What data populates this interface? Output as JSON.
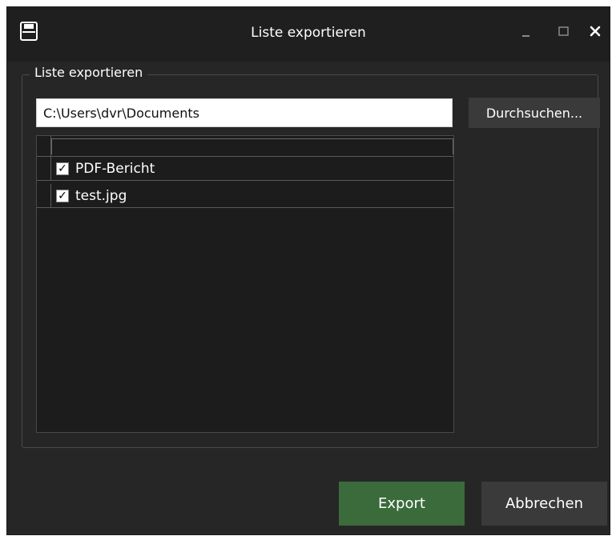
{
  "window": {
    "title": "Liste exportieren",
    "app_icon": "save-icon",
    "controls": [
      "minimize-icon",
      "maximize-icon",
      "close-icon"
    ]
  },
  "group": {
    "label": "Liste exportieren"
  },
  "path": {
    "value": "C:\\Users\\dvr\\Documents"
  },
  "browse": {
    "label": "Durchsuchen..."
  },
  "list": {
    "items": [
      {
        "label": "PDF-Bericht",
        "checked": true
      },
      {
        "label": "test.jpg",
        "checked": true
      }
    ]
  },
  "actions": {
    "export_label": "Export",
    "cancel_label": "Abbrechen"
  },
  "colors": {
    "window_bg": "#262626",
    "titlebar_bg": "#1f1f1f",
    "export_bg": "#3b6b3b",
    "button_bg": "#3a3a3a"
  }
}
